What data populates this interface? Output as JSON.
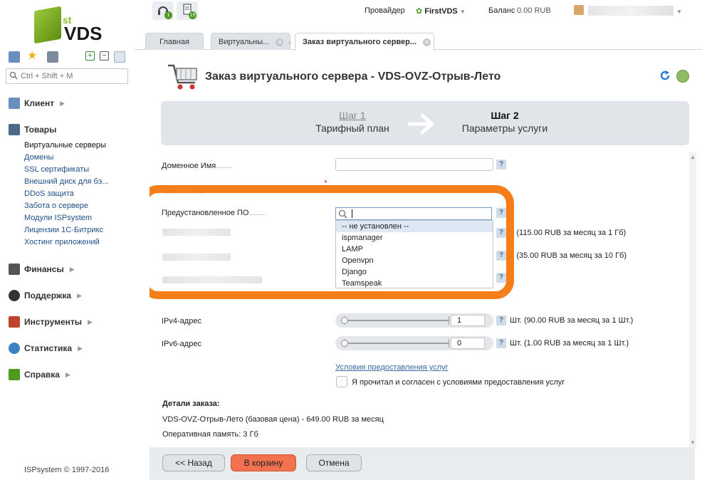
{
  "logo": {
    "sup": "st",
    "text": "VDS"
  },
  "search": {
    "placeholder": "Ctrl + Shift + M"
  },
  "sidebar": {
    "sections": [
      {
        "label": "Клиент",
        "color": "#6a8fbf"
      },
      {
        "label": "Товары",
        "color": "#4a6a8a"
      },
      {
        "label": "Финансы",
        "color": "#555555"
      },
      {
        "label": "Поддержка",
        "color": "#333333"
      },
      {
        "label": "Инструменты",
        "color": "#c0442b"
      },
      {
        "label": "Статистика",
        "color": "#3a82c5"
      },
      {
        "label": "Справка",
        "color": "#4e9a1e"
      }
    ],
    "products_submenu": [
      "Виртуальные серверы",
      "Домены",
      "SSL сертификаты",
      "Внешний диск для бэ...",
      "DDoS защита",
      "Забота о сервере",
      "Модули ISPsystem",
      "Лицензии 1С-Битрикс",
      "Хостинг приложений"
    ],
    "copyright": "ISPsystem © 1997-2016"
  },
  "topbar": {
    "notif1_count": "1",
    "notif2_count": "19",
    "provider_label": "Провайдер",
    "provider_value": "FirstVDS",
    "balance_label": "Баланс",
    "balance_value": "0.00 RUB"
  },
  "tabs": [
    {
      "label": "Главная"
    },
    {
      "label": "Виртуальны..."
    },
    {
      "label": "Заказ виртуального сервер..."
    }
  ],
  "page": {
    "title": "Заказ виртуального сервера - VDS-OVZ-Отрыв-Лето",
    "step1_num": "Шаг 1",
    "step1_desc": "Тарифный план",
    "step2_num": "Шаг 2",
    "step2_desc": "Параметры услуги"
  },
  "form": {
    "domain_label": "Доменное Имя",
    "preinstalled_label": "Предустановленное ПО",
    "dropdown_options": [
      "-- не установлен --",
      "ispmanager",
      "LAMP",
      "Openvpn",
      "Django",
      "Teamspeak"
    ],
    "price_ram": "б (115.00 RUB за месяц за 1 Гб)",
    "price_disk": "б (35.00 RUB за месяц за 10 Гб)",
    "ipv4_label": "IPv4-адрес",
    "ipv4_value": "1",
    "ipv4_price": "Шт. (90.00 RUB за месяц за 1 Шт.)",
    "ipv6_label": "IPv6-адрес",
    "ipv6_value": "0",
    "ipv6_price": "Шт. (1.00 RUB за месяц за 1 Шт.)",
    "terms_link": "Условия предоставления услуг",
    "agree_text": "Я прочитал и согласен с условиями предоставления услуг",
    "qmark": "?"
  },
  "details": {
    "title": "Детали заказа:",
    "line1": "VDS-OVZ-Отрыв-Лето (базовая цена) - 649.00 RUB за месяц",
    "line2": "Оперативная память: 3 Гб"
  },
  "buttons": {
    "back": "<< Назад",
    "cart": "В корзину",
    "cancel": "Отмена"
  },
  "colors": {
    "accent_orange": "#f57d1a",
    "primary_button": "#f2714f",
    "link": "#3a68a0"
  }
}
